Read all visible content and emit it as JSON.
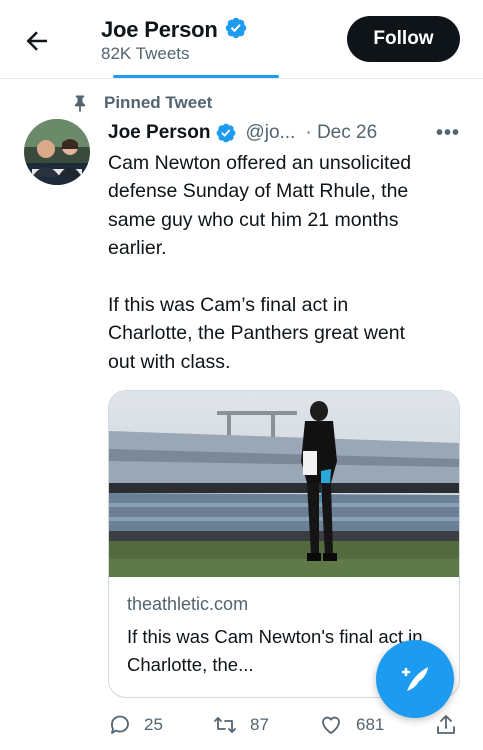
{
  "header": {
    "back_icon": "back-arrow-icon",
    "name": "Joe Person",
    "tweet_count": "82K Tweets",
    "follow_label": "Follow"
  },
  "pinned": {
    "label": "Pinned Tweet",
    "icon": "pin-icon"
  },
  "tweet": {
    "name": "Joe Person",
    "handle": "@jo...",
    "date": "· Dec 26",
    "more": "•••",
    "text": "Cam Newton offered an unsolicited\ndefense Sunday of Matt Rhule, the\nsame guy who cut him 21 months\nearlier.\n\nIf this was Cam’s final act in\nCharlotte, the Panthers great went\nout with class.",
    "card": {
      "domain": "theathletic.com",
      "title": "If this was Cam Newton's final act in Charlotte, the..."
    },
    "actions": {
      "replies": "25",
      "retweets": "87",
      "likes": "681"
    }
  },
  "colors": {
    "accent": "#1d9bf0",
    "text": "#0f1419",
    "secondary": "#536471",
    "follow_bg": "#0f1419"
  }
}
